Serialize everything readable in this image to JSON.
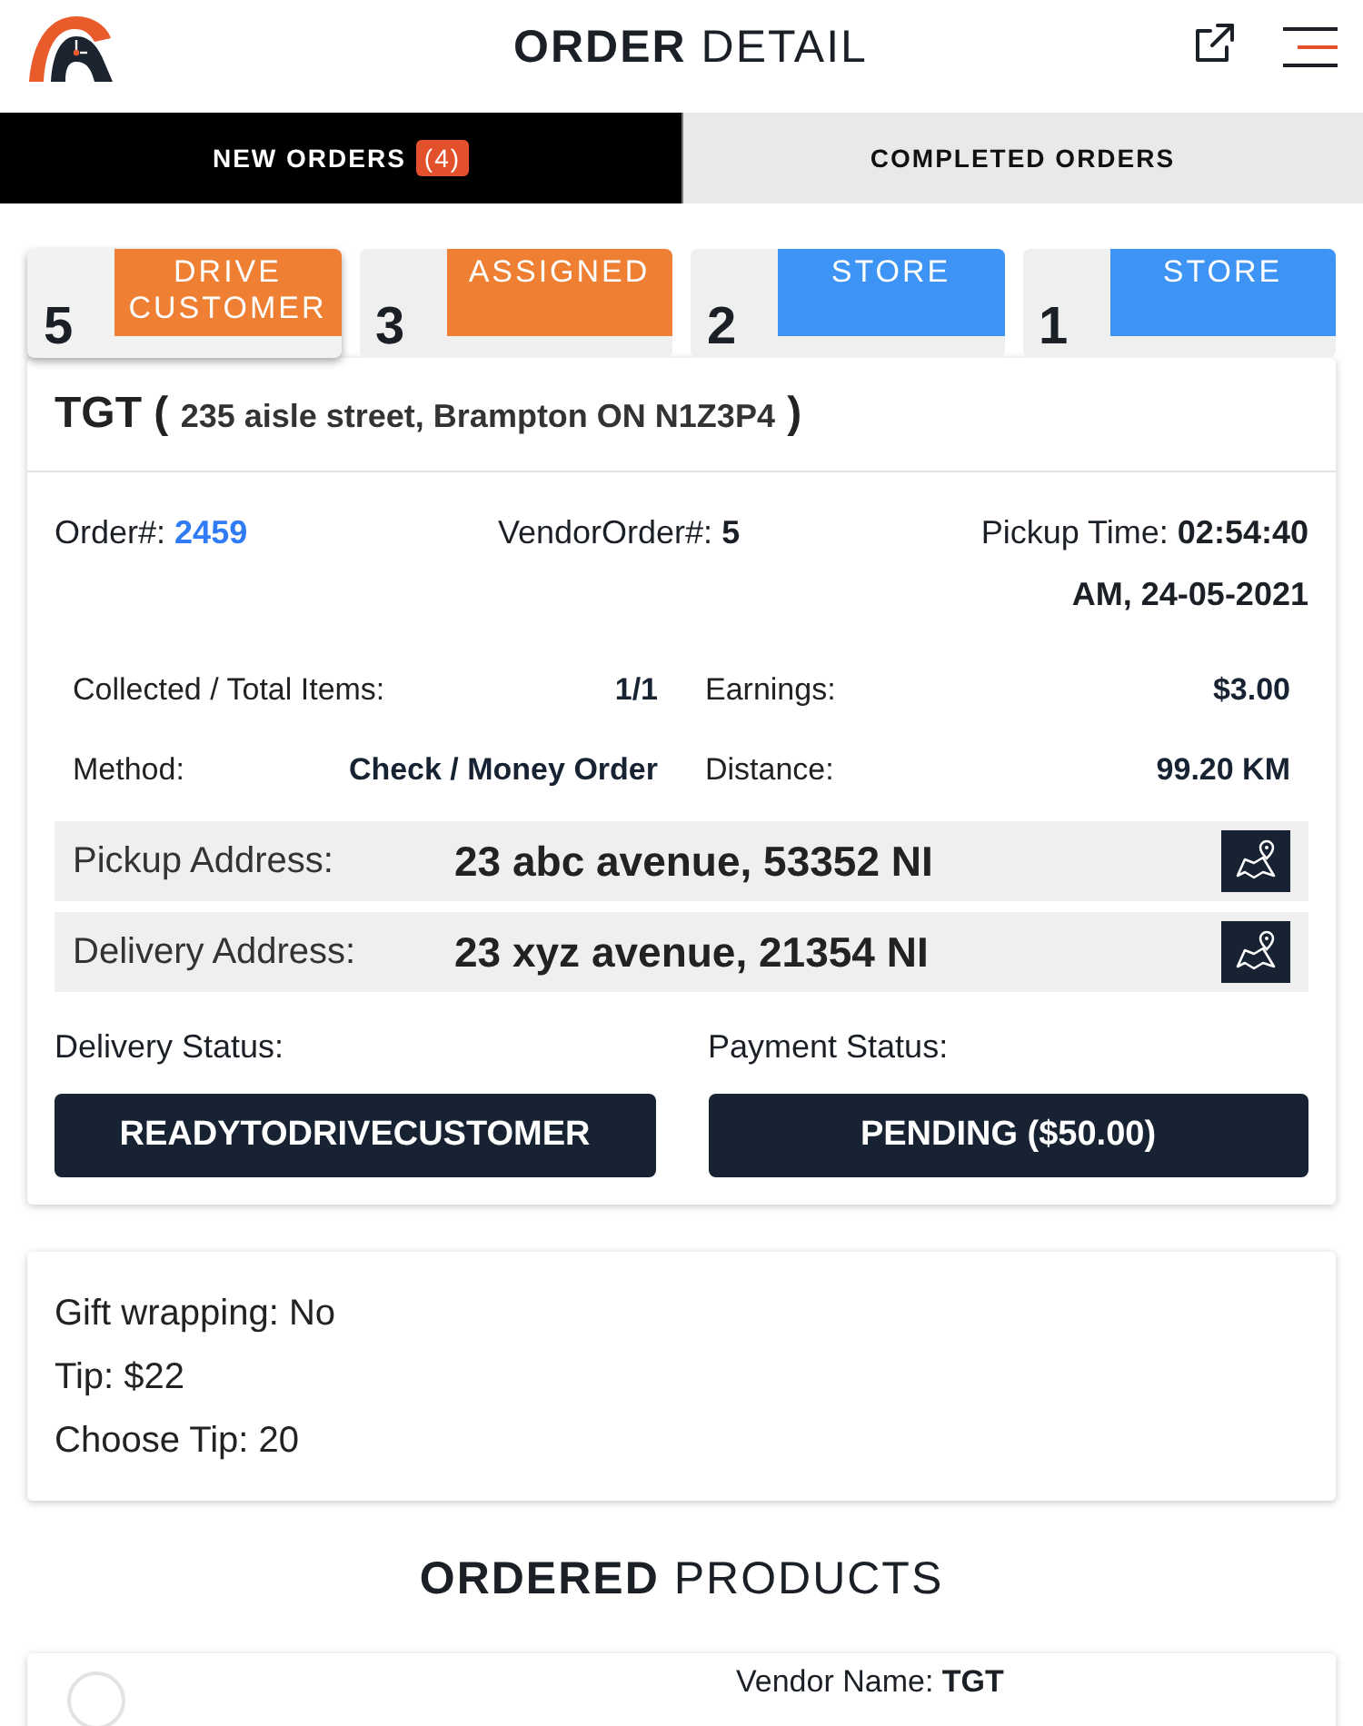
{
  "header": {
    "title": "**ORDER** DETAIL"
  },
  "tabs": [
    {
      "label": "NEW ORDERS",
      "badge": "(4)",
      "selected": true
    },
    {
      "label": "COMPLETED ORDERS",
      "selected": false
    }
  ],
  "steps": [
    {
      "number": "5",
      "label": "DRIVE CUSTOMER",
      "color": "#ee7f33",
      "selected": true
    },
    {
      "number": "3",
      "label": "ASSIGNED",
      "color": "#ee7f33",
      "selected": false
    },
    {
      "number": "2",
      "label": "STORE",
      "color": "#3d94f5",
      "selected": false
    },
    {
      "number": "1",
      "label": "STORE",
      "color": "#3d94f5",
      "selected": false
    }
  ],
  "order": {
    "heading": "TGT ( **235 aisle street, Brampton ON N1Z3P4** )",
    "meta": [
      {
        "label": "Order#:",
        "value": "2459",
        "kind": "link"
      },
      {
        "label": "VendorOrder#:",
        "value": "5",
        "kind": "text"
      },
      {
        "label": "Pickup Time:",
        "value": "02:54:40 AM, 24-05-2021",
        "kind": "text"
      }
    ],
    "details": [
      {
        "label": "Collected / Total Items:",
        "value": "1/1"
      },
      {
        "label": "Earnings:",
        "value": "$3.00"
      },
      {
        "label": "Method:",
        "value": "Check / Money Order"
      },
      {
        "label": "Distance:",
        "value": "99.20 KM"
      }
    ],
    "addresses": [
      {
        "label": "Pickup Address:",
        "value": "23 abc avenue, 53352 NI"
      },
      {
        "label": "Delivery Address:",
        "value": "23 xyz avenue, 21354 NI"
      }
    ],
    "statuses": [
      {
        "label": "Delivery Status:",
        "value": "READYTODRIVECUSTOMER"
      },
      {
        "label": "Payment Status:",
        "value": "PENDING ($50.00)"
      }
    ]
  },
  "extras": [
    "Gift wrapping: No",
    "Tip: $22",
    "Choose Tip: 20"
  ],
  "products": {
    "title": "**ORDERED** PRODUCTS",
    "items": [
      {
        "vendor_label": "Vendor Name:",
        "vendor": "TGT"
      }
    ]
  }
}
